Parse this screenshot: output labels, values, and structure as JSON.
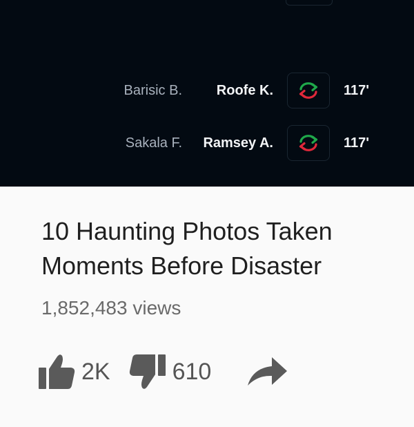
{
  "substitutions": [
    {
      "player_out": "Barisic B.",
      "player_in": "Roofe K.",
      "minute": "117'",
      "icon": "substitution-arrows-icon"
    },
    {
      "player_out": "Sakala F.",
      "player_in": "Ramsey A.",
      "minute": "117'",
      "icon": "substitution-arrows-icon"
    }
  ],
  "video": {
    "title": "10 Haunting Photos Taken Moments Before Disaster",
    "views": "1,852,483 views",
    "like_count": "2K",
    "dislike_count": "610",
    "icons": {
      "like": "thumbs-up-icon",
      "dislike": "thumbs-down-icon",
      "share": "share-arrow-icon"
    }
  },
  "colors": {
    "dark_bg": "#030a12",
    "sub_in_green": "#1fa84a",
    "sub_out_red": "#e0283a",
    "icon_gray": "#5a5a5a"
  }
}
